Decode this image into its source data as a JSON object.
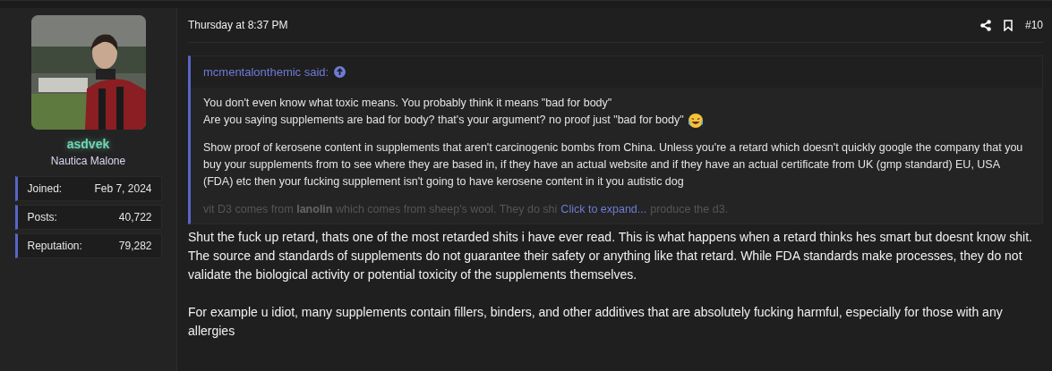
{
  "user": {
    "name": "asdvek",
    "title": "Nautica Malone",
    "stats": [
      {
        "label": "Joined:",
        "value": "Feb 7, 2024"
      },
      {
        "label": "Posts:",
        "value": "40,722"
      },
      {
        "label": "Reputation:",
        "value": "79,282"
      }
    ]
  },
  "post": {
    "time": "Thursday at 8:37 PM",
    "number": "#10",
    "quote": {
      "author": "mcmentalonthemic said:",
      "lines": [
        "You don't even know what toxic means. You probably think it means \"bad for body\"",
        "Are you saying supplements are bad for body? that's your argument? no proof just \"bad for body\""
      ],
      "paragraph": "Show proof of kerosene content in supplements that aren't carcinogenic bombs from China. Unless you're a retard which doesn't quickly google the company that you buy your supplements from to see where they are based in, if they have an actual website and if they have an actual certificate from UK (gmp standard) EU, USA (FDA) etc then your fucking supplement isn't going to have kerosene content in it you autistic dog",
      "faded_before": "vit D3 comes from **lanolin** which comes from sheep's wool. They do shi",
      "faded_after": "produce the d3.",
      "expand": "Click to expand..."
    },
    "body": [
      "Shut the fuck up retard, thats one of the most retarded shits i have ever read. This is what happens when a retard thinks hes smart but doesnt know shit. The source and standards of supplements do not guarantee their safety or anything like that retard. While FDA standards make processes, they do not validate the biological activity or potential toxicity of the supplements themselves.",
      "For example u idiot, many supplements contain fillers, binders, and other additives that are absolutely fucking harmful, especially for those with any allergies"
    ]
  }
}
